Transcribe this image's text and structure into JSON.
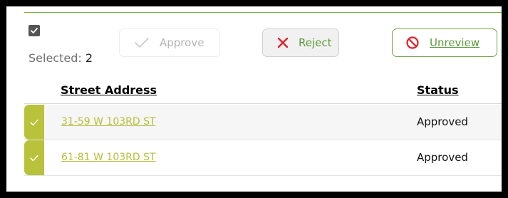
{
  "toolbar": {
    "selected_label": "Selected:",
    "selected_count": "2",
    "approve_label": "Approve",
    "reject_label": "Reject",
    "unreview_label": "Unreview"
  },
  "table": {
    "columns": [
      "Street Address",
      "Status"
    ],
    "rows": [
      {
        "address": "31-59 W 103RD ST",
        "status": "Approved",
        "checked": true
      },
      {
        "address": "61-81 W 103RD ST",
        "status": "Approved",
        "checked": true
      }
    ]
  },
  "icons": {
    "select_all": "checkbox-checked-icon",
    "approve": "checkmark-icon",
    "reject": "x-icon",
    "unreview": "prohibited-icon",
    "row_check": "checkmark-icon"
  },
  "colors": {
    "accent_green": "#5b9b3c",
    "row_check_bg": "#b8c23a",
    "link_color": "#b6bf3a",
    "reject_red": "#e0202a",
    "top_rule": "#7db24a"
  }
}
